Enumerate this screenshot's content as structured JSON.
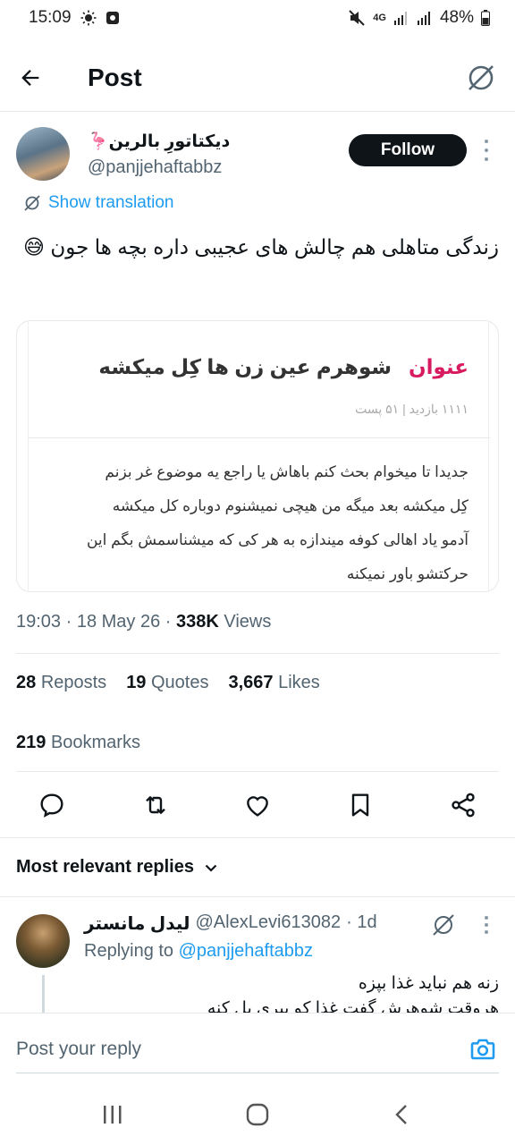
{
  "status_bar": {
    "time": "15:09",
    "network": "4G",
    "battery": "48%"
  },
  "header": {
    "title": "Post"
  },
  "post": {
    "author_name": "دیکتاتورِ بالرین🦩",
    "author_handle": "@panjjehaftabbz",
    "follow_label": "Follow",
    "translation_label": "Show translation",
    "text": "زندگی متاهلی هم چالش های عجیبی داره بچه ها جون 😅",
    "timestamp": "19:03 · 18 May 26 · ",
    "views_count": "338K",
    "views_label": " Views"
  },
  "quote_card": {
    "label": "عنوان",
    "title": "شوهرم عین زن ها کِل میکشه",
    "meta": "۱۱۱۱ بازدید  | ۵۱ پست",
    "body_lines": {
      "l1": "جدیدا تا میخوام بحث کنم باهاش یا راجع یه موضوع غر بزنم",
      "l2": "کِل میکشه بعد میگه من هیچی نمیشنوم دوباره کل میکشه",
      "l3": "آدمو یاد اهالی کوفه میندازه به هر کی که میشناسمش بگم این",
      "l4": "حرکتشو باور نمیکنه"
    }
  },
  "stats": {
    "reposts_count": "28",
    "reposts_label": "Reposts",
    "quotes_count": "19",
    "quotes_label": "Quotes",
    "likes_count": "3,667",
    "likes_label": "Likes",
    "bookmarks_count": "219",
    "bookmarks_label": "Bookmarks"
  },
  "replies": {
    "sort_label": "Most relevant replies",
    "first": {
      "name": "لیدل مانستر",
      "handle": "@AlexLevi613082",
      "age": "· 1d",
      "replying_prefix": "Replying to ",
      "replying_handle": "@panjjehaftabbz",
      "line1": "زنه هم نباید غذا بپزه",
      "line2": "هروقت شوهرش گفت غذا کو بپری بل کنه"
    }
  },
  "compose": {
    "placeholder": "Post your reply"
  },
  "icons": {
    "back": "arrow-left-icon",
    "grok": "grok-icon",
    "more": "more-vertical-icon",
    "reply": "reply-icon",
    "repost": "repost-icon",
    "like": "heart-icon",
    "bookmark": "bookmark-icon",
    "share": "share-icon",
    "camera": "camera-icon"
  },
  "colors": {
    "accent": "#1d9bf0",
    "text": "#0f1419",
    "secondary": "#536471",
    "quote_label": "#d81b60"
  }
}
